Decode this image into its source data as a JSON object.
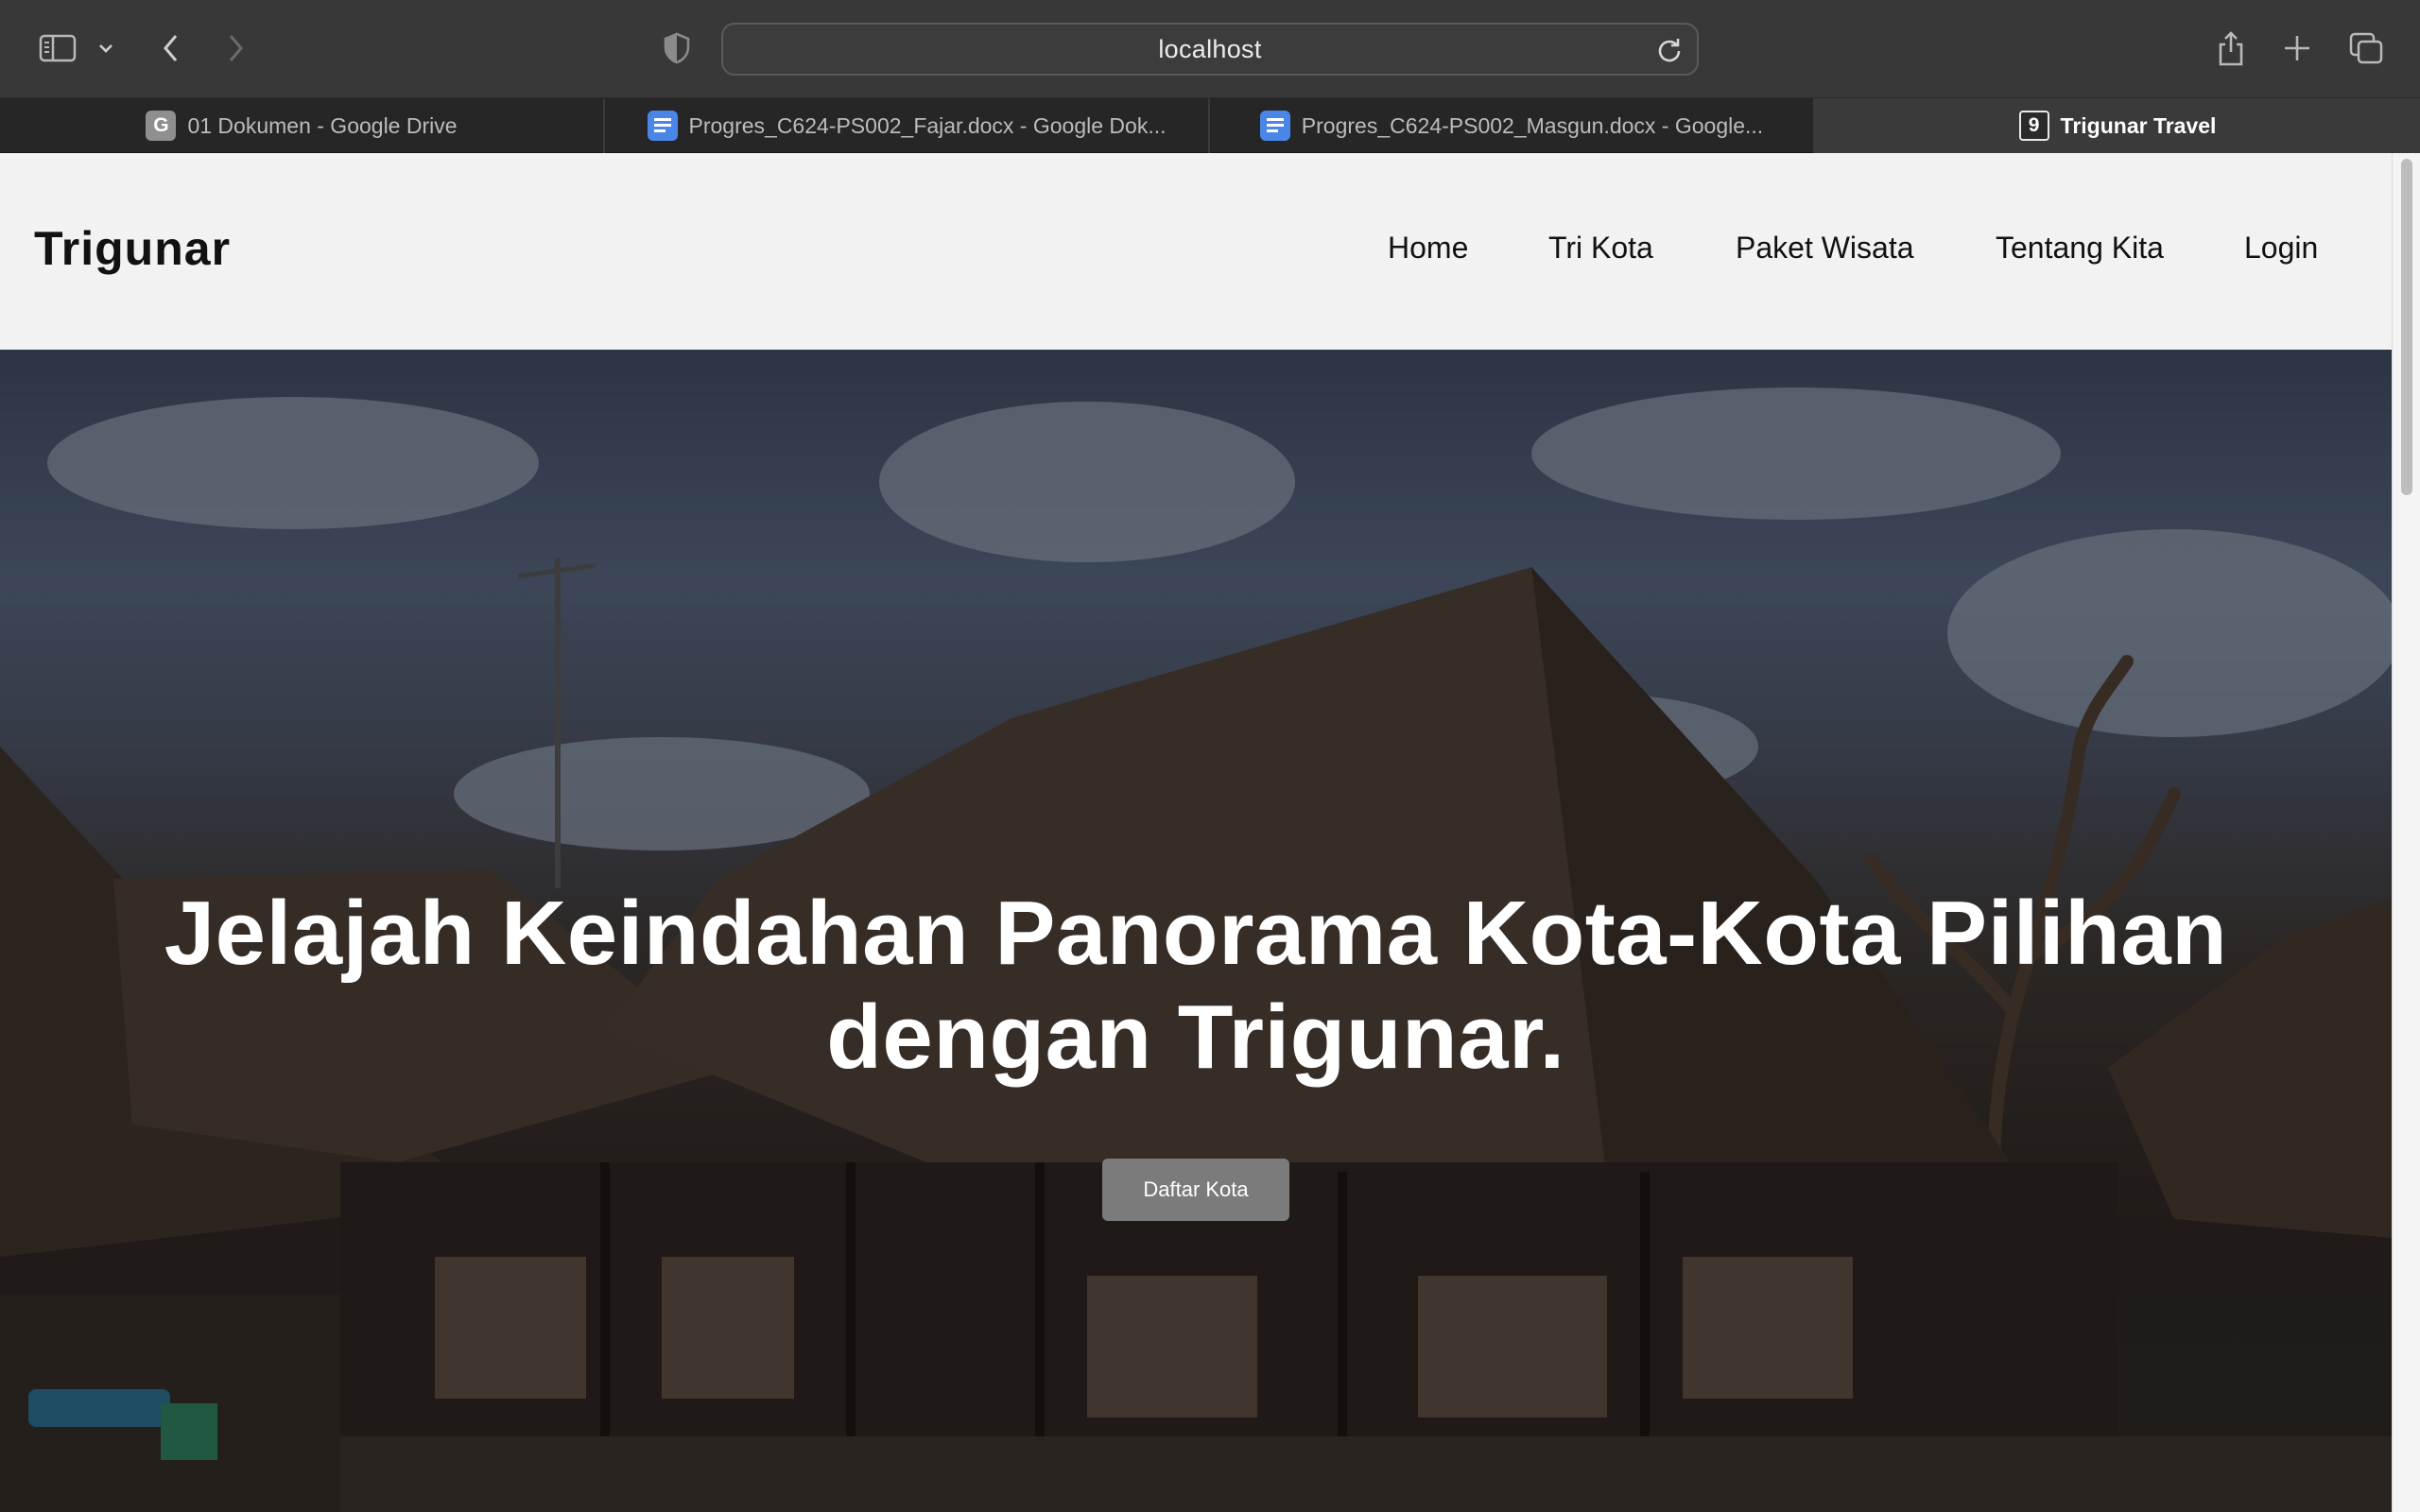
{
  "browser": {
    "url": "localhost",
    "tabs": [
      {
        "title": "01 Dokumen - Google Drive",
        "icon": "G"
      },
      {
        "title": "Progres_C624-PS002_Fajar.docx - Google Dok...",
        "icon": "docs"
      },
      {
        "title": "Progres_C624-PS002_Masgun.docx - Google...",
        "icon": "docs"
      },
      {
        "title": "Trigunar Travel",
        "icon": "9"
      }
    ]
  },
  "site": {
    "brand": "Trigunar",
    "nav": [
      "Home",
      "Tri Kota",
      "Paket Wisata",
      "Tentang Kita",
      "Login"
    ]
  },
  "hero": {
    "title_line1": "Jelajah Keindahan Panorama Kota-Kota Pilihan",
    "title_line2": "dengan Trigunar.",
    "button": "Daftar Kota"
  }
}
